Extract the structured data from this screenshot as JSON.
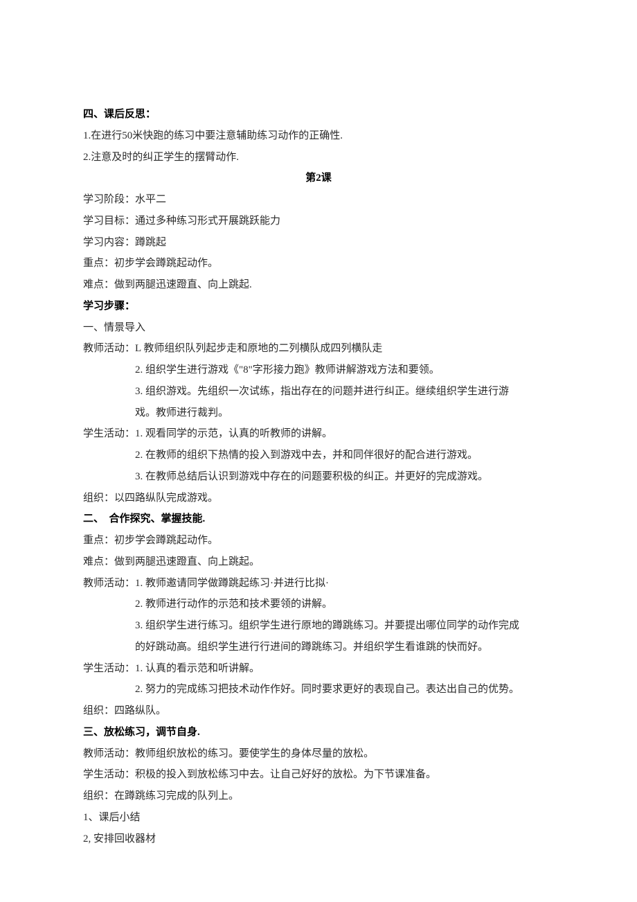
{
  "s1": {
    "h": "四、课后反思：",
    "p1": "1.在进行50米快跑的练习中要注意辅助练习动作的正确性.",
    "p2": "2.注意及时的纠正学生的摆臂动作."
  },
  "title2": "第2课",
  "s2": {
    "stage": "学习阶段：水平二",
    "goal": "学习目标：通过多种练习形式开展跳跃能力",
    "content": "学习内容：蹲跳起",
    "key": "重点：初步学会蹲跳起动作。",
    "hard": "难点：做到两腿迅速蹬直、向上跳起.",
    "steps": "学习步骤：",
    "sec1h": "一、情景导入",
    "t1": "教师活动：L 教师组织队列起步走和原地的二列横队成四列横队走",
    "t2": "2. 组织学生进行游戏《\"8\"字形接力跑》教师讲解游戏方法和要领。",
    "t3": "3. 组织游戏。先组织一次试练，指出存在的问题并进行纠正。继续组织学生进行游",
    "t3b": "戏。教师进行裁判。",
    "st1": "学生活动：1. 观看同学的示范，认真的听教师的讲解。",
    "st2": "2. 在教师的组织下热情的投入到游戏中去，并和同伴很好的配合进行游戏。",
    "st3": "3. 在教师总结后认识到游戏中存在的问题要积极的纠正。并更好的完成游戏。",
    "org1": "组织：以四路纵队完成游戏。",
    "sec2h": "二、　合作探究、掌握技能.",
    "key2": "重点：初步学会蹲跳起动作。",
    "hard2": "难点：做到两腿迅速蹬直、向上跳起。",
    "ta1": "教师活动：1. 教师邀请同学做蹲跳起练习·并进行比拟·",
    "ta2": "2. 教师进行动作的示范和技术要领的讲解。",
    "ta3": "3. 组织学生进行练习。组织学生进行原地的蹲跳练习。并要提出哪位同学的动作完成",
    "ta3b": "的好跳动高。组织学生进行行进间的蹲跳练习。并组织学生看谁跳的快而好。",
    "sa1": "学生活动：1. 认真的看示范和听讲解。",
    "sa2": "2. 努力的完成练习把技术动作作好。同时要求更好的表现自己。表达出自己的优势。",
    "org2": "组织：四路纵队。",
    "sec3h": "三、放松练习，调节自身.",
    "r1": "教师活动：教师组织放松的练习。要使学生的身体尽量的放松。",
    "r2": "学生活动：积极的投入到放松练习中去。让自己好好的放松。为下节课准备。",
    "r3": "组织：在蹲跳练习完成的队列上。",
    "e1": "1、课后小结",
    "e2": "2, 安排回收器材"
  }
}
